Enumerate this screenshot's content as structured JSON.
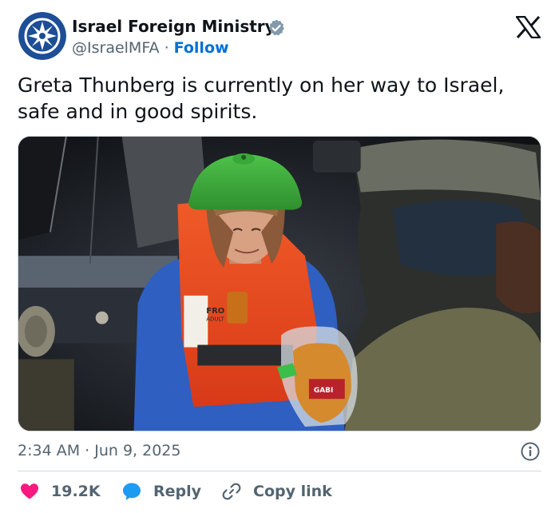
{
  "author": {
    "name": "Israel Foreign Ministry",
    "handle": "@IsraelMFA",
    "separator": "·",
    "follow_label": "Follow"
  },
  "tweet": {
    "text": "Greta Thunberg is currently on her way to Israel, safe and in good spirits."
  },
  "photo": {
    "vest_text_1": "FRO",
    "vest_text_2": "ADULT",
    "bag_label": "GABI"
  },
  "meta": {
    "timestamp": "2:34 AM · Jun 9, 2025"
  },
  "actions": {
    "likes": "19.2K",
    "reply_label": "Reply",
    "copy_label": "Copy link"
  },
  "colors": {
    "brand_blue": "#1d4e96",
    "follow_blue": "#006fd6",
    "like_pink": "#f91880",
    "reply_blue": "#1d9bf0",
    "text_secondary": "#536471"
  },
  "icons": {
    "verified": "verified-badge-icon",
    "logo": "x-logo-icon",
    "info": "info-icon",
    "like": "heart-icon",
    "reply": "speech-bubble-icon",
    "copy": "link-icon"
  }
}
